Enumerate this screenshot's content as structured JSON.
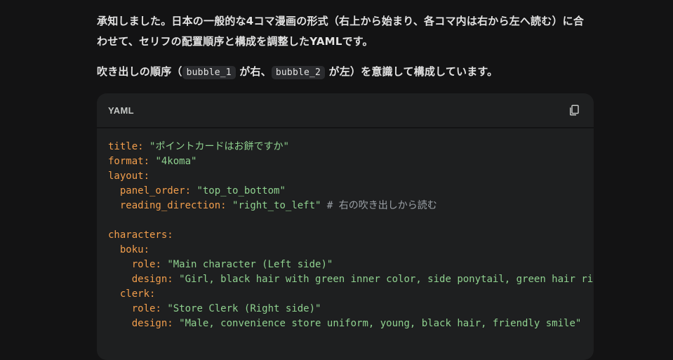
{
  "response": {
    "paragraph1": "承知しました。日本の一般的な4コマ漫画の形式（右上から始まり、各コマ内は右から左へ読む）に合わせて、セリフの配置順序と構成を調整したYAMLです。",
    "paragraph2_pre": "吹き出しの順序（",
    "code1": "bubble_1",
    "paragraph2_mid": "が右、",
    "code2": "bubble_2",
    "paragraph2_post": "が左）を意識して構成しています。"
  },
  "code_block": {
    "language": "YAML",
    "copy_icon": "copy-icon",
    "lines": [
      {
        "indent": "",
        "key": "title",
        "value": "\"ポイントカードはお餅ですか\"",
        "comment": ""
      },
      {
        "indent": "",
        "key": "format",
        "value": "\"4koma\"",
        "comment": ""
      },
      {
        "indent": "",
        "key": "layout",
        "value": "",
        "comment": ""
      },
      {
        "indent": "  ",
        "key": "panel_order",
        "value": "\"top_to_bottom\"",
        "comment": ""
      },
      {
        "indent": "  ",
        "key": "reading_direction",
        "value": "\"right_to_left\"",
        "comment": "# 右の吹き出しから読む"
      },
      {
        "indent": "",
        "key": "",
        "value": "",
        "comment": ""
      },
      {
        "indent": "",
        "key": "characters",
        "value": "",
        "comment": ""
      },
      {
        "indent": "  ",
        "key": "boku",
        "value": "",
        "comment": ""
      },
      {
        "indent": "    ",
        "key": "role",
        "value": "\"Main character (Left side)\"",
        "comment": ""
      },
      {
        "indent": "    ",
        "key": "design",
        "value": "\"Girl, black hair with green inner color, side ponytail, green hair ribbon",
        "comment": ""
      },
      {
        "indent": "  ",
        "key": "clerk",
        "value": "",
        "comment": ""
      },
      {
        "indent": "    ",
        "key": "role",
        "value": "\"Store Clerk (Right side)\"",
        "comment": ""
      },
      {
        "indent": "    ",
        "key": "design",
        "value": "\"Male, convenience store uniform, young, black hair, friendly smile\"",
        "comment": ""
      }
    ]
  }
}
